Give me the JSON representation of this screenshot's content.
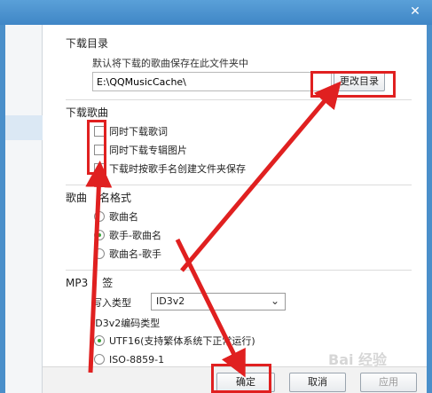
{
  "download_dir": {
    "title": "下载目录",
    "hint": "默认将下载的歌曲保存在此文件夹中",
    "path": "E:\\QQMusicCache\\",
    "change_button": "更改目录"
  },
  "download_songs": {
    "title": "下载歌曲",
    "options": [
      {
        "label": "同时下载歌词",
        "checked": false
      },
      {
        "label": "同时下载专辑图片",
        "checked": false
      },
      {
        "label": "下载时按歌手名创建文件夹保存",
        "checked": false
      }
    ]
  },
  "filename_format": {
    "title": "歌曲文件名格式",
    "title_visible": "歌曲",
    "title_tail": "名格式",
    "options": [
      {
        "label": "歌曲名",
        "selected": false
      },
      {
        "label": "歌手-歌曲名",
        "selected": true
      },
      {
        "label": "歌曲名-歌手",
        "selected": false
      }
    ]
  },
  "mp3_tag": {
    "title_head": "MP3",
    "title_tail": "签",
    "write_type_label": "写入类型",
    "write_type_value": "ID3v2",
    "encoding_label": "ID3v2编码类型",
    "encodings": [
      {
        "label": "UTF16(支持繁体系统下正常运行)",
        "selected": true
      },
      {
        "label": "ISO-8859-1",
        "selected": false
      }
    ]
  },
  "footer": {
    "ok": "确定",
    "cancel": "取消",
    "apply": "应用"
  },
  "titlebar": {
    "close_icon": "close-icon"
  },
  "watermark": "Bai 经验",
  "colors": {
    "annotation_red": "#e02020",
    "radio_selected": "#3aa33a",
    "titlebar": "#4a8fca"
  }
}
